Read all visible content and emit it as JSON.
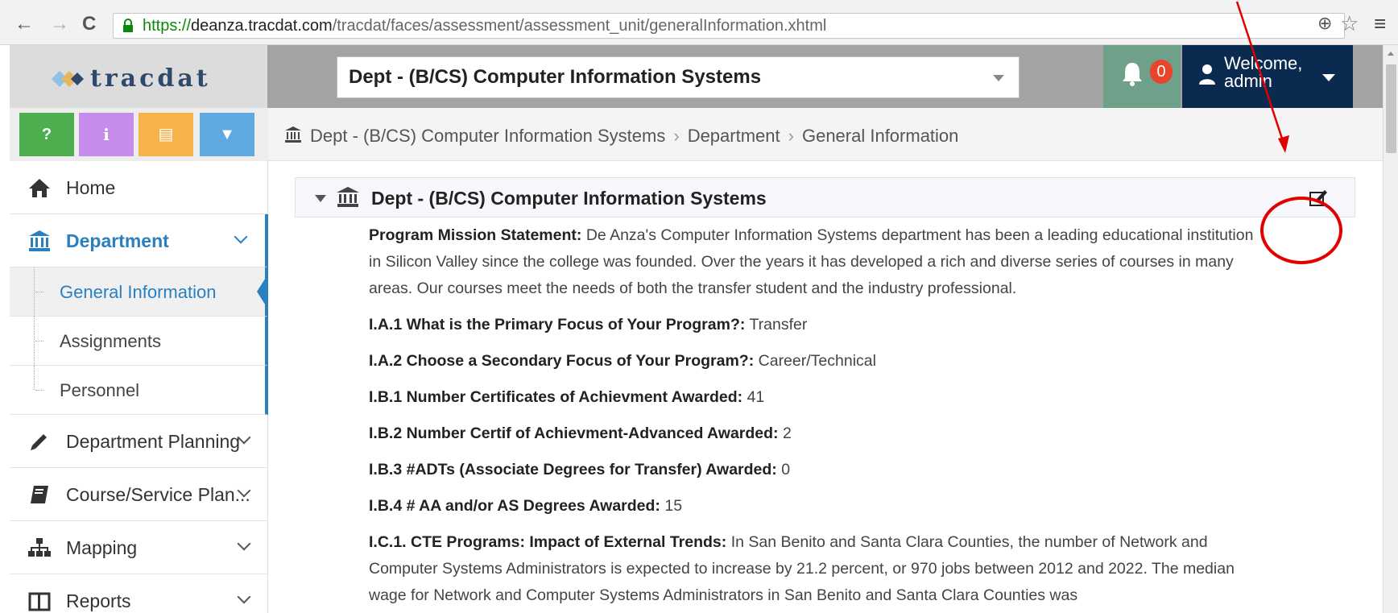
{
  "browser": {
    "url_scheme": "https://",
    "url_host": "deanza.trac",
    "url_host2": "dat.com",
    "url_path": "/tracdat/faces/assessment/assessment_unit/generalInformation.xhtml",
    "back_icon": "back-arrow-icon",
    "forward_icon": "forward-arrow-icon",
    "reload_icon": "reload-icon",
    "back": "←",
    "forward": "→",
    "reload": "C",
    "zoom": "⊕",
    "star": "☆",
    "menu": "≡"
  },
  "header": {
    "logo_text": "tracdat",
    "dept_selector": "Dept - (B/CS) Computer Information Systems",
    "notification_count": "0",
    "welcome_line1": "Welcome,",
    "welcome_line2": "admin"
  },
  "quick_buttons": [
    {
      "label": "?",
      "color": "#4cae4f",
      "icon": "help-icon"
    },
    {
      "label": "i",
      "color": "#c58cec",
      "icon": "info-icon"
    },
    {
      "label": "▤",
      "color": "#f7b24a",
      "icon": "list-icon"
    },
    {
      "label": "▼",
      "color": "#5ea9e0",
      "icon": "filter-icon"
    }
  ],
  "sidebar": {
    "home": "Home",
    "department": "Department",
    "sub": [
      "General Information",
      "Assignments",
      "Personnel"
    ],
    "planning": "Department Planning",
    "course": "Course/Service Plan...",
    "mapping": "Mapping",
    "reports": "Reports"
  },
  "breadcrumb": [
    "Dept - (B/CS) Computer Information Systems",
    "Department",
    "General Information"
  ],
  "breadcrumb_sep": "›",
  "panel": {
    "title": "Dept - (B/CS) Computer Information Systems"
  },
  "fields": [
    {
      "label": "Program Mission Statement:",
      "value": "De Anza's Computer Information Systems department has been a leading educational institution in Silicon Valley since the college was founded. Over the years it has developed a rich and diverse series of courses in many areas. Our courses meet the needs of both the transfer student and the industry professional."
    },
    {
      "label": "I.A.1 What is the Primary Focus of Your Program?:",
      "value": "Transfer"
    },
    {
      "label": "I.A.2 Choose a Secondary Focus of Your Program?:",
      "value": "Career/Technical"
    },
    {
      "label": "I.B.1 Number Certificates of Achievment Awarded:",
      "value": "41"
    },
    {
      "label": "I.B.2 Number Certif of Achievment-Advanced Awarded:",
      "value": "2"
    },
    {
      "label": "I.B.3 #ADTs (Associate Degrees for Transfer) Awarded:",
      "value": "0"
    },
    {
      "label": "I.B.4 # AA and/or AS Degrees Awarded:",
      "value": "15"
    },
    {
      "label": "I.C.1. CTE Programs: Impact of External Trends:",
      "value": "In San Benito and Santa Clara Counties, the number of Network and Computer Systems Administrators is expected to increase by 21.2 percent, or 970 jobs between 2012 and 2022. The median wage for Network and Computer Systems Administrators in San Benito and Santa Clara Counties was"
    }
  ],
  "colors": {
    "accent": "#2a7fc0",
    "header_bg": "#a3a3a3",
    "user_bg": "#0b2a4f",
    "bell_bg": "#6fa08a",
    "badge": "#e8452c",
    "annotation": "#e00000"
  }
}
